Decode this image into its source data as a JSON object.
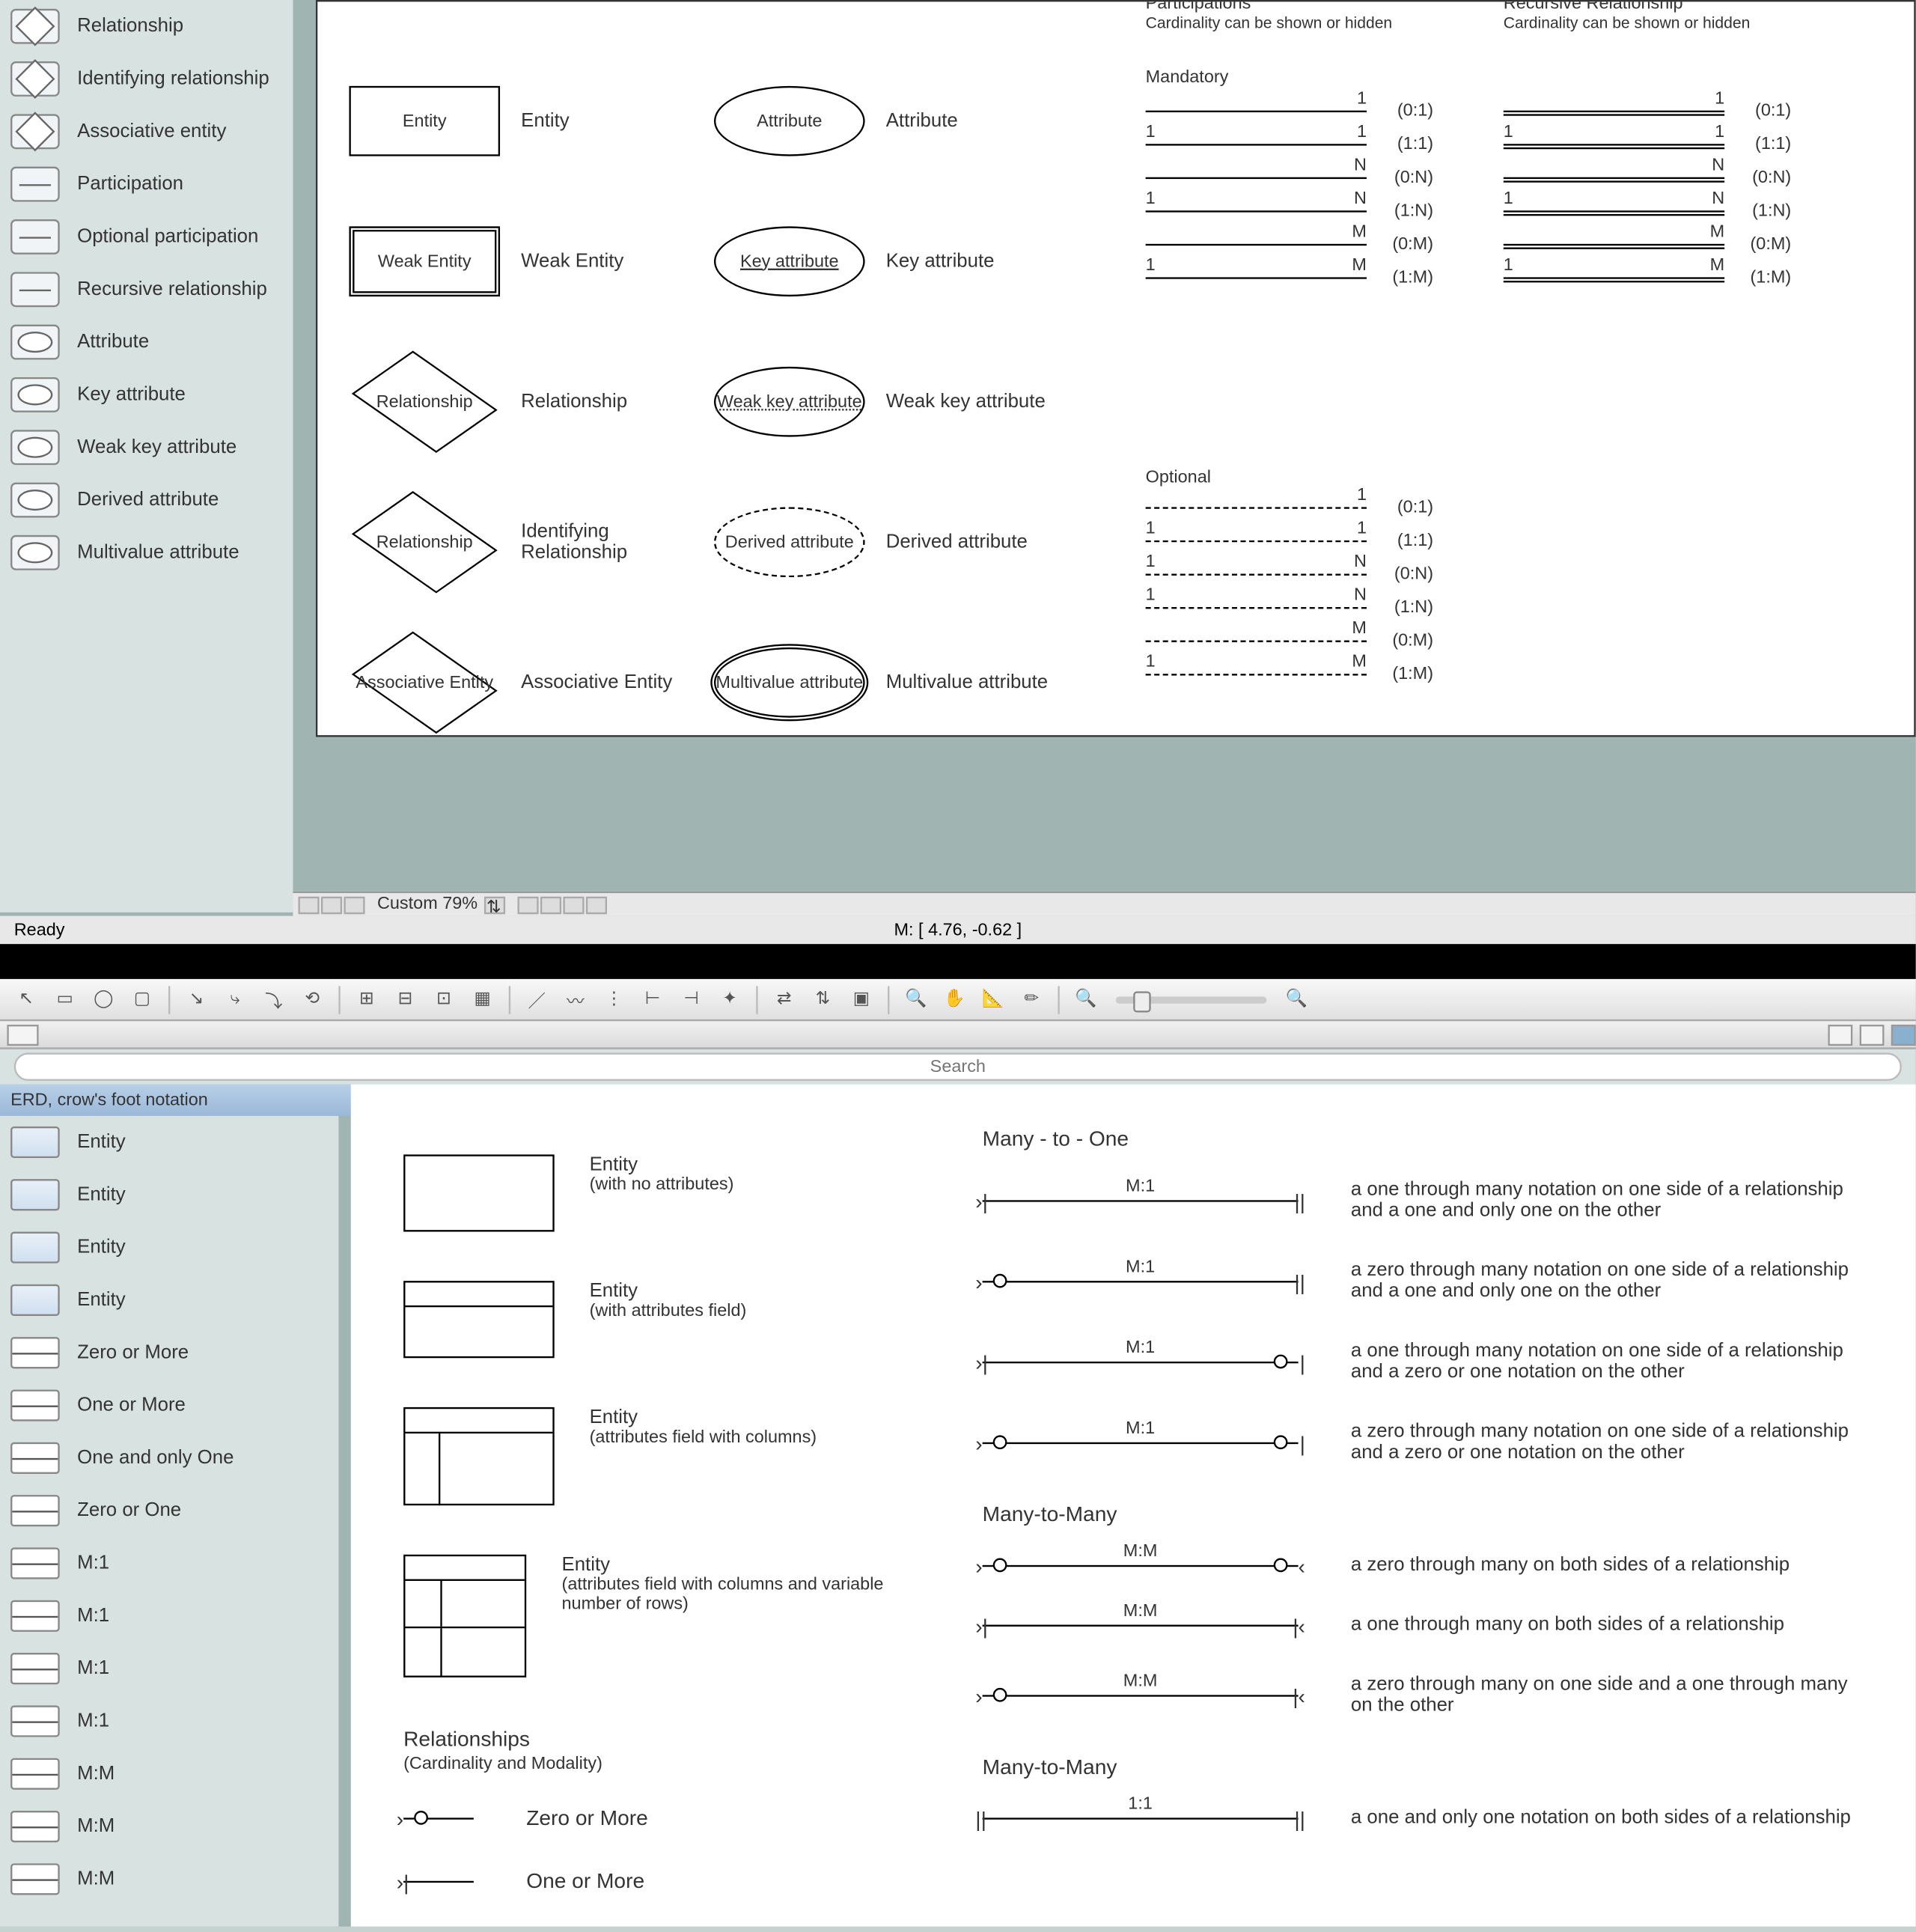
{
  "top_sidebar": {
    "items": [
      {
        "label": "Relationship"
      },
      {
        "label": "Identifying relationship"
      },
      {
        "label": "Associative entity"
      },
      {
        "label": "Participation"
      },
      {
        "label": "Optional participation"
      },
      {
        "label": "Recursive relationship"
      },
      {
        "label": "Attribute"
      },
      {
        "label": "Key attribute"
      },
      {
        "label": "Weak key attribute"
      },
      {
        "label": "Derived attribute"
      },
      {
        "label": "Multivalue attribute"
      }
    ]
  },
  "top_canvas": {
    "participations_hdr": "Participations",
    "participations_sub": "Cardinality can be shown or hidden",
    "recursive_hdr": "Recursive Relationship",
    "recursive_sub": "Cardinality can be shown or hidden",
    "mandatory_label": "Mandatory",
    "optional_label": "Optional",
    "rows": [
      {
        "shape": "Entity",
        "shape_lbl": "Entity",
        "attr_shape": "Attribute",
        "attr_lbl": "Attribute"
      },
      {
        "shape": "Weak Entity",
        "shape_lbl": "Weak Entity",
        "attr_shape": "Key attribute",
        "attr_lbl": "Key attribute"
      },
      {
        "shape": "Relationship",
        "shape_lbl": "Relationship",
        "attr_shape": "Weak key attribute",
        "attr_lbl": "Weak key attribute"
      },
      {
        "shape": "Relationship",
        "shape_lbl": "Identifying Relationship",
        "attr_shape": "Derived attribute",
        "attr_lbl": "Derived attribute"
      },
      {
        "shape": "Associative Entity",
        "shape_lbl": "Associative Entity",
        "attr_shape": "Multivalue attribute",
        "attr_lbl": "Multivalue attribute"
      }
    ],
    "mandatory_lines": [
      {
        "l": "",
        "r": "1",
        "card": "(0:1)"
      },
      {
        "l": "1",
        "r": "1",
        "card": "(1:1)"
      },
      {
        "l": "",
        "r": "N",
        "card": "(0:N)"
      },
      {
        "l": "1",
        "r": "N",
        "card": "(1:N)"
      },
      {
        "l": "",
        "r": "M",
        "card": "(0:M)"
      },
      {
        "l": "1",
        "r": "M",
        "card": "(1:M)"
      }
    ],
    "optional_lines": [
      {
        "l": "",
        "r": "1",
        "card": "(0:1)"
      },
      {
        "l": "1",
        "r": "1",
        "card": "(1:1)"
      },
      {
        "l": "1",
        "r": "N",
        "card": "(0:N)"
      },
      {
        "l": "1",
        "r": "N",
        "card": "(1:N)"
      },
      {
        "l": "",
        "r": "M",
        "card": "(0:M)"
      },
      {
        "l": "1",
        "r": "M",
        "card": "(1:M)"
      }
    ]
  },
  "top_status": {
    "zoom": "Custom 79%",
    "coords": "M: [ 4.76, -0.62 ]",
    "ready": "Ready"
  },
  "bottom_toolbar": {
    "search_placeholder": "Search",
    "stencil_title": "ERD, crow's foot notation"
  },
  "bottom_sidebar": {
    "items": [
      {
        "label": "Entity"
      },
      {
        "label": "Entity"
      },
      {
        "label": "Entity"
      },
      {
        "label": "Entity"
      },
      {
        "label": "Zero or More"
      },
      {
        "label": "One or More"
      },
      {
        "label": "One and only One"
      },
      {
        "label": "Zero or One"
      },
      {
        "label": "M:1"
      },
      {
        "label": "M:1"
      },
      {
        "label": "M:1"
      },
      {
        "label": "M:1"
      },
      {
        "label": "M:M"
      },
      {
        "label": "M:M"
      },
      {
        "label": "M:M"
      }
    ]
  },
  "bottom_canvas": {
    "many_to_one_title": "Many - to - One",
    "many_to_many_title": "Many-to-Many",
    "many_to_many_title2": "Many-to-Many",
    "relationships_title": "Relationships",
    "relationships_sub": "(Cardinality and Modality)",
    "zero_or_more": "Zero or More",
    "one_or_more": "One or More",
    "one_to_one": "1:1",
    "one_to_one_desc": "a one and only one notation on both sides of a relationship",
    "entities": [
      {
        "title": "Entity",
        "sub": "(with no attributes)",
        "h": 44,
        "rows": 0
      },
      {
        "title": "Entity",
        "sub": "(with attributes field)",
        "h": 44,
        "rows": 1
      },
      {
        "title": "Entity",
        "sub": "(attributes field with columns)",
        "h": 56,
        "rows": 1,
        "cols": true
      },
      {
        "title": "Entity",
        "sub": "(attributes field with columns and variable number of rows)",
        "h": 70,
        "rows": 2,
        "cols": true
      }
    ],
    "m1_rows": [
      {
        "lbl": "M:1",
        "desc": "a one through many notation on one side of a relationship and a one and only one on the other"
      },
      {
        "lbl": "M:1",
        "desc": "a zero through many notation on one side of a relationship and a one and only one on the other"
      },
      {
        "lbl": "M:1",
        "desc": "a one through many notation on one side of a relationship and a zero or one notation on the other"
      },
      {
        "lbl": "M:1",
        "desc": "a zero through many notation on one side of a relationship and a zero or one notation on the other"
      }
    ],
    "mm_rows": [
      {
        "lbl": "M:M",
        "desc": "a zero through many on both sides of a relationship"
      },
      {
        "lbl": "M:M",
        "desc": "a one through many on both sides of a relationship"
      },
      {
        "lbl": "M:M",
        "desc": "a zero through many on one side and a one through many on the other"
      }
    ]
  }
}
